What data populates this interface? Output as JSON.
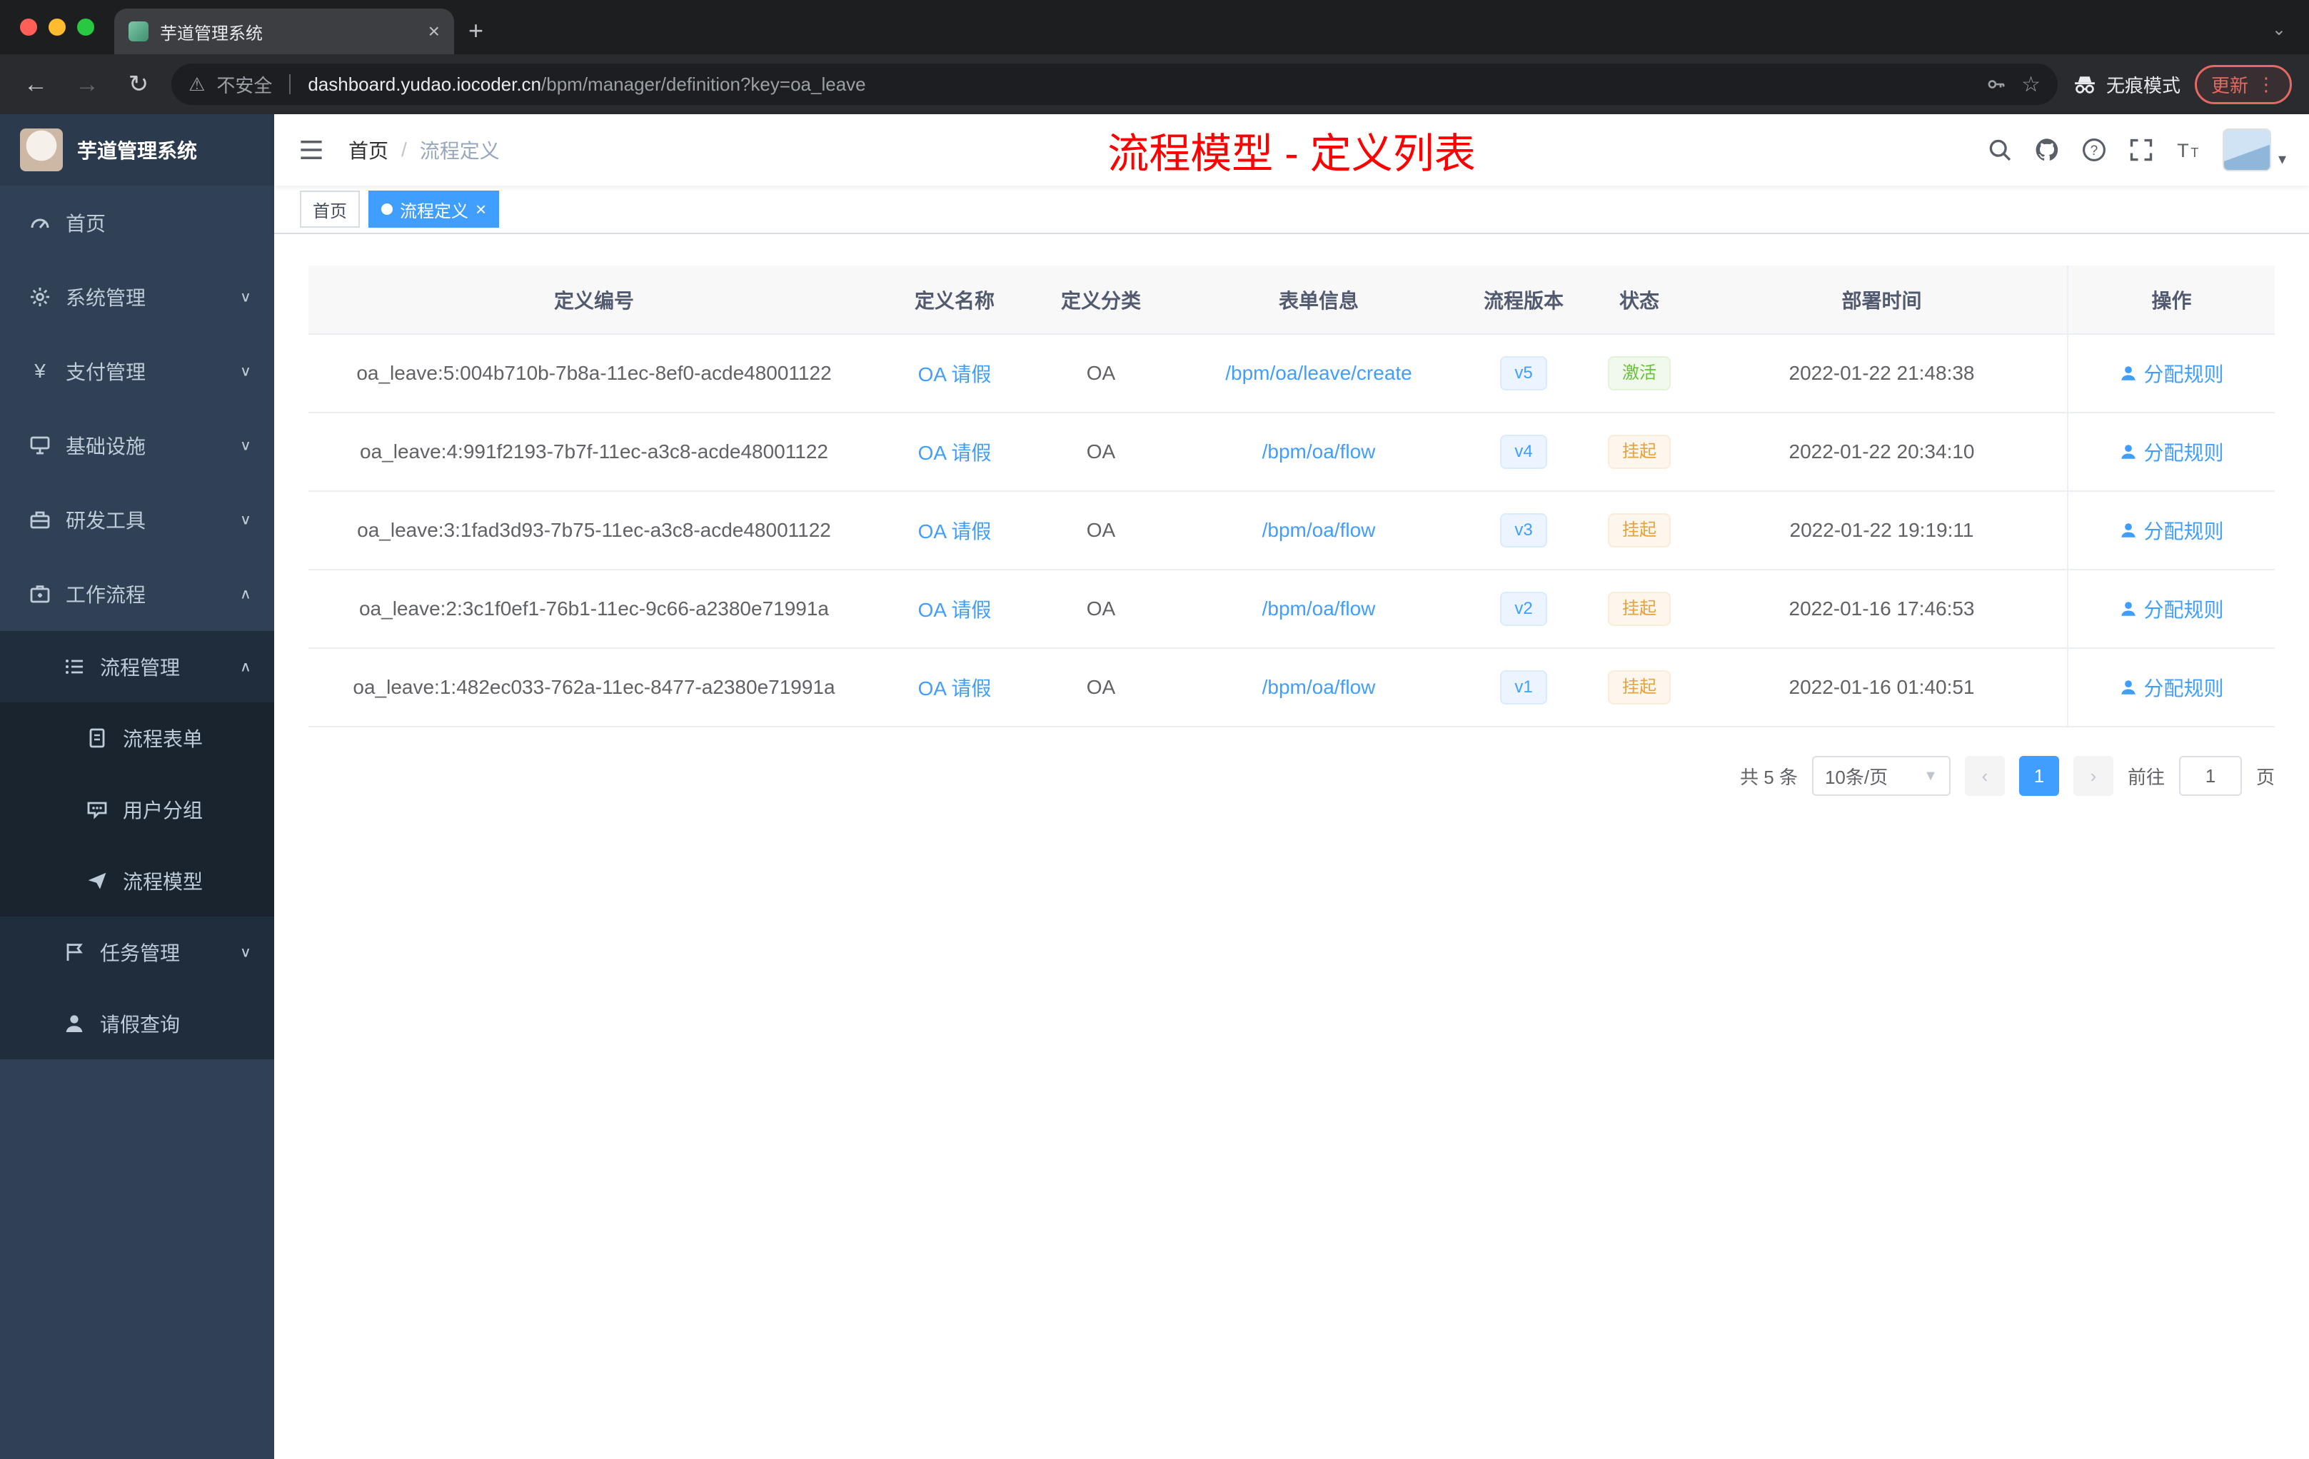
{
  "browser": {
    "tab_title": "芋道管理系统",
    "security_label": "不安全",
    "url_host": "dashboard.yudao.iocoder.cn",
    "url_path": "/bpm/manager/definition?key=oa_leave",
    "incognito_label": "无痕模式",
    "update_label": "更新"
  },
  "sidebar": {
    "logo_title": "芋道管理系统",
    "items": [
      {
        "label": "首页"
      },
      {
        "label": "系统管理"
      },
      {
        "label": "支付管理"
      },
      {
        "label": "基础设施"
      },
      {
        "label": "研发工具"
      },
      {
        "label": "工作流程"
      },
      {
        "label": "流程管理"
      },
      {
        "label": "流程表单"
      },
      {
        "label": "用户分组"
      },
      {
        "label": "流程模型"
      },
      {
        "label": "任务管理"
      },
      {
        "label": "请假查询"
      }
    ]
  },
  "header": {
    "breadcrumb_home": "首页",
    "breadcrumb_separator": "/",
    "breadcrumb_current": "流程定义",
    "annotation": "流程模型 - 定义列表"
  },
  "tags": {
    "home": "首页",
    "current": "流程定义",
    "close": "×"
  },
  "table": {
    "columns": [
      "定义编号",
      "定义名称",
      "定义分类",
      "表单信息",
      "流程版本",
      "状态",
      "部署时间",
      "操作"
    ],
    "rows": [
      {
        "id": "oa_leave:5:004b710b-7b8a-11ec-8ef0-acde48001122",
        "name": "OA 请假",
        "category": "OA",
        "form": "/bpm/oa/leave/create",
        "version": "v5",
        "status": "激活",
        "status_type": "success",
        "deployed": "2022-01-22 21:48:38",
        "action": "分配规则"
      },
      {
        "id": "oa_leave:4:991f2193-7b7f-11ec-a3c8-acde48001122",
        "name": "OA 请假",
        "category": "OA",
        "form": "/bpm/oa/flow",
        "version": "v4",
        "status": "挂起",
        "status_type": "warning",
        "deployed": "2022-01-22 20:34:10",
        "action": "分配规则"
      },
      {
        "id": "oa_leave:3:1fad3d93-7b75-11ec-a3c8-acde48001122",
        "name": "OA 请假",
        "category": "OA",
        "form": "/bpm/oa/flow",
        "version": "v3",
        "status": "挂起",
        "status_type": "warning",
        "deployed": "2022-01-22 19:19:11",
        "action": "分配规则"
      },
      {
        "id": "oa_leave:2:3c1f0ef1-76b1-11ec-9c66-a2380e71991a",
        "name": "OA 请假",
        "category": "OA",
        "form": "/bpm/oa/flow",
        "version": "v2",
        "status": "挂起",
        "status_type": "warning",
        "deployed": "2022-01-16 17:46:53",
        "action": "分配规则"
      },
      {
        "id": "oa_leave:1:482ec033-762a-11ec-8477-a2380e71991a",
        "name": "OA 请假",
        "category": "OA",
        "form": "/bpm/oa/flow",
        "version": "v1",
        "status": "挂起",
        "status_type": "warning",
        "deployed": "2022-01-16 01:40:51",
        "action": "分配规则"
      }
    ]
  },
  "pagination": {
    "total": "共 5 条",
    "page_size": "10条/页",
    "page": "1",
    "goto_label": "前往",
    "goto_value": "1",
    "unit_label": "页"
  },
  "colors": {
    "accent": "#409eff",
    "success": "#67c23a",
    "warning": "#e6a23c",
    "annotation_red": "#ff0000"
  }
}
